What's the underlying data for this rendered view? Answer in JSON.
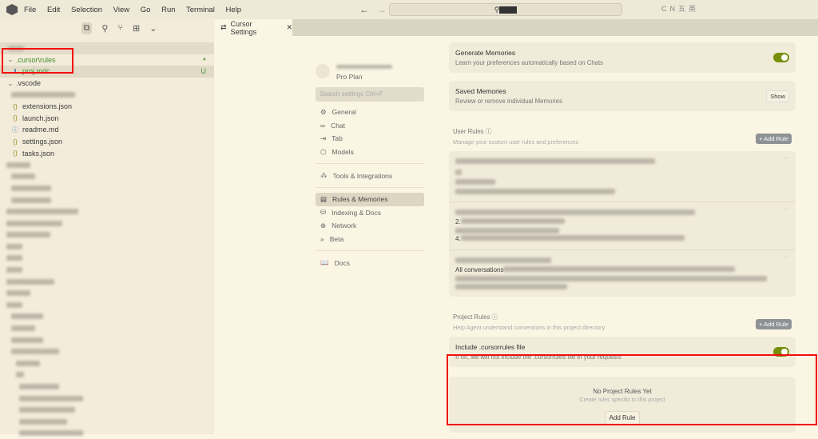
{
  "titlebar": {
    "menu": [
      "File",
      "Edit",
      "Selection",
      "View",
      "Go",
      "Run",
      "Terminal",
      "Help"
    ],
    "ime": [
      "CN",
      "五",
      "英"
    ]
  },
  "explorer": {
    "items": [
      {
        "label": ".cursor\\rules",
        "type": "folder",
        "git": "●"
      },
      {
        "label": "proj.mdc",
        "type": "file",
        "git": "U"
      },
      {
        "label": ".vscode",
        "type": "folder"
      },
      {
        "label": "extensions.json",
        "type": "json"
      },
      {
        "label": "launch.json",
        "type": "json"
      },
      {
        "label": "readme.md",
        "type": "info"
      },
      {
        "label": "settings.json",
        "type": "json"
      },
      {
        "label": "tasks.json",
        "type": "json"
      }
    ]
  },
  "tab": {
    "label": "Cursor Settings",
    "close": "✕"
  },
  "settings_nav": {
    "plan": "Pro Plan",
    "search_placeholder": "Search settings Ctrl+F",
    "items": [
      {
        "label": "General",
        "icon": "⚙"
      },
      {
        "label": "Chat",
        "icon": "∞"
      },
      {
        "label": "Tab",
        "icon": "⇥"
      },
      {
        "label": "Models",
        "icon": "⬡"
      },
      {
        "label": "Tools & Integrations",
        "icon": "⁂"
      },
      {
        "label": "Rules & Memories",
        "icon": "▤"
      },
      {
        "label": "Indexing & Docs",
        "icon": "⛁"
      },
      {
        "label": "Network",
        "icon": "⊕"
      },
      {
        "label": "Beta",
        "icon": "»"
      },
      {
        "label": "Docs",
        "icon": "📖"
      }
    ]
  },
  "content": {
    "generate_memories": {
      "title": "Generate Memories",
      "desc": "Learn your preferences automatically based on Chats",
      "enabled": true
    },
    "saved_memories": {
      "title": "Saved Memories",
      "desc": "Review or remove individual Memories",
      "button": "Show"
    },
    "user_rules": {
      "title": "User Rules",
      "desc": "Manage your custom user rules and preferences",
      "add": "+ Add Rule",
      "rule_prefixes": [
        "",
        "2.",
        "4.",
        "All conversations"
      ]
    },
    "project_rules": {
      "title": "Project Rules",
      "desc": "Help Agent understand conventions in this project directory",
      "add": "+ Add Rule"
    },
    "include_cursorrules": {
      "title": "Include .cursorrules file",
      "desc": "If off, we will not include the .cursorrules file in your requests",
      "enabled": true
    },
    "empty": {
      "title": "No Project Rules Yet",
      "desc": "Create rules specific to this project",
      "button": "Add Rule"
    }
  },
  "colors": {
    "accent_toggle": "#76900a",
    "highlight": "#f20f0f"
  }
}
